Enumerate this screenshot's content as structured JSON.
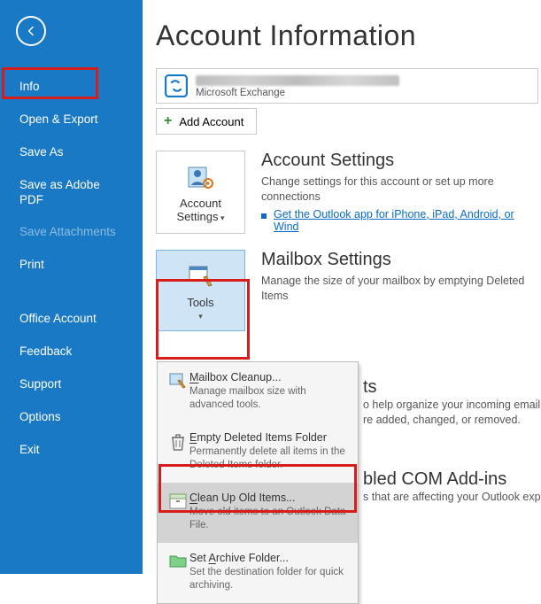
{
  "sidebar": {
    "items": [
      {
        "label": "Info",
        "active": true,
        "disabled": false
      },
      {
        "label": "Open & Export",
        "active": false,
        "disabled": false
      },
      {
        "label": "Save As",
        "active": false,
        "disabled": false
      },
      {
        "label": "Save as Adobe PDF",
        "active": false,
        "disabled": false
      },
      {
        "label": "Save Attachments",
        "active": false,
        "disabled": true
      },
      {
        "label": "Print",
        "active": false,
        "disabled": false
      }
    ],
    "lower": [
      {
        "label": "Office Account"
      },
      {
        "label": "Feedback"
      },
      {
        "label": "Support"
      },
      {
        "label": "Options"
      },
      {
        "label": "Exit"
      }
    ]
  },
  "page_title": "Account Information",
  "account": {
    "subtext": "Microsoft Exchange",
    "add_label": "Add Account"
  },
  "account_settings": {
    "button_line1": "Account",
    "button_line2": "Settings",
    "title": "Account Settings",
    "desc": "Change settings for this account or set up more connections",
    "link": "Get the Outlook app for iPhone, iPad, Android, or Wind"
  },
  "mailbox_settings": {
    "button_label": "Tools",
    "title": "Mailbox Settings",
    "desc": "Manage the size of your mailbox by emptying Deleted Items"
  },
  "tools_menu": [
    {
      "icon": "cleanup",
      "title": "Mailbox Cleanup...",
      "desc": "Manage mailbox size with advanced tools."
    },
    {
      "icon": "trash",
      "title": "Empty Deleted Items Folder",
      "desc": "Permanently delete all items in the Deleted Items folder."
    },
    {
      "icon": "archive",
      "title": "Clean Up Old Items...",
      "desc": "Move old items to an Outlook Data File.",
      "selected": true
    },
    {
      "icon": "folder",
      "title": "Set Archive Folder...",
      "desc": "Set the destination folder for quick archiving."
    }
  ],
  "peek_rules": {
    "title_suffix": "ts",
    "desc1": "o help organize your incoming email m",
    "desc2": "re added, changed, or removed."
  },
  "peek_com": {
    "title": "bled COM Add-ins",
    "desc": "s that are affecting your Outlook experi"
  }
}
